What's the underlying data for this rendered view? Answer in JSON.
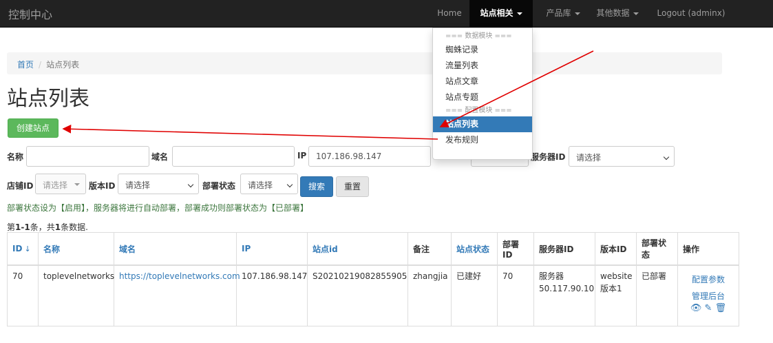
{
  "navbar": {
    "brand": "控制中心",
    "items": [
      {
        "label": "Home"
      },
      {
        "label": "站点相关"
      },
      {
        "label": "产品库"
      },
      {
        "label": "其他数据"
      },
      {
        "label": "Logout (adminx)"
      }
    ]
  },
  "dropdown": {
    "header_data": "=== 数据模块 ===",
    "items_data": [
      "蜘蛛记录",
      "流量列表",
      "站点文章",
      "站点专题"
    ],
    "header_config": "=== 配置模块 ===",
    "items_config": [
      "站点列表",
      "发布规则"
    ]
  },
  "breadcrumb": {
    "home": "首页",
    "separator": "/",
    "current": "站点列表"
  },
  "page_title": "站点列表",
  "create_button": "创建站点",
  "filters": {
    "name_label": "名称",
    "name_value": "",
    "domain_label": "域名",
    "domain_value": "",
    "ip_label": "IP",
    "ip_value": "107.186.98.147",
    "server_label": "服务器ID",
    "server_value": "请选择",
    "shop_label": "店铺ID",
    "shop_value": "请选择",
    "version_label": "版本ID",
    "version_value": "请选择",
    "deploy_label": "部署状态",
    "deploy_value": "请选择",
    "search_button": "搜索",
    "reset_button": "重置"
  },
  "hint": "部署状态设为【启用】，服务器将进行自动部署，部署成功则部署状态为【已部署】",
  "summary": {
    "prefix": "第",
    "range": "1-1",
    "middle": "条，共",
    "total": "1",
    "suffix": "条数据."
  },
  "table": {
    "headers": {
      "id": "ID",
      "name": "名称",
      "domain": "域名",
      "ip": "IP",
      "site_id": "站点id",
      "remark": "备注",
      "site_status": "站点状态",
      "deploy_id": "部署ID",
      "server_id": "服务器ID",
      "version_id": "版本ID",
      "deploy_status": "部署状态",
      "actions": "操作"
    },
    "rows": [
      {
        "id": "70",
        "name": "toplevelnetworks",
        "domain": "https://toplevelnetworks.com",
        "ip": "107.186.98.147",
        "site_id": "S20210219082855905",
        "remark": "zhangjia",
        "site_status": "已建好",
        "deploy_id": "70",
        "server_line1": "服务器",
        "server_line2": "50.117.90.10",
        "version_line1": "website",
        "version_line2": "版本1",
        "deploy_status": "已部署",
        "action_config": "配置参数",
        "action_admin": "管理后台"
      }
    ]
  },
  "icons": [
    "sort-icon",
    "caret-down-icon",
    "eye-icon",
    "pencil-icon",
    "trash-icon",
    "arrow-annotation"
  ],
  "colors": {
    "navbar": "#222222",
    "primary": "#337ab7",
    "success": "#5cb85c",
    "hint": "#3c763d",
    "annotation": "#e00000"
  }
}
